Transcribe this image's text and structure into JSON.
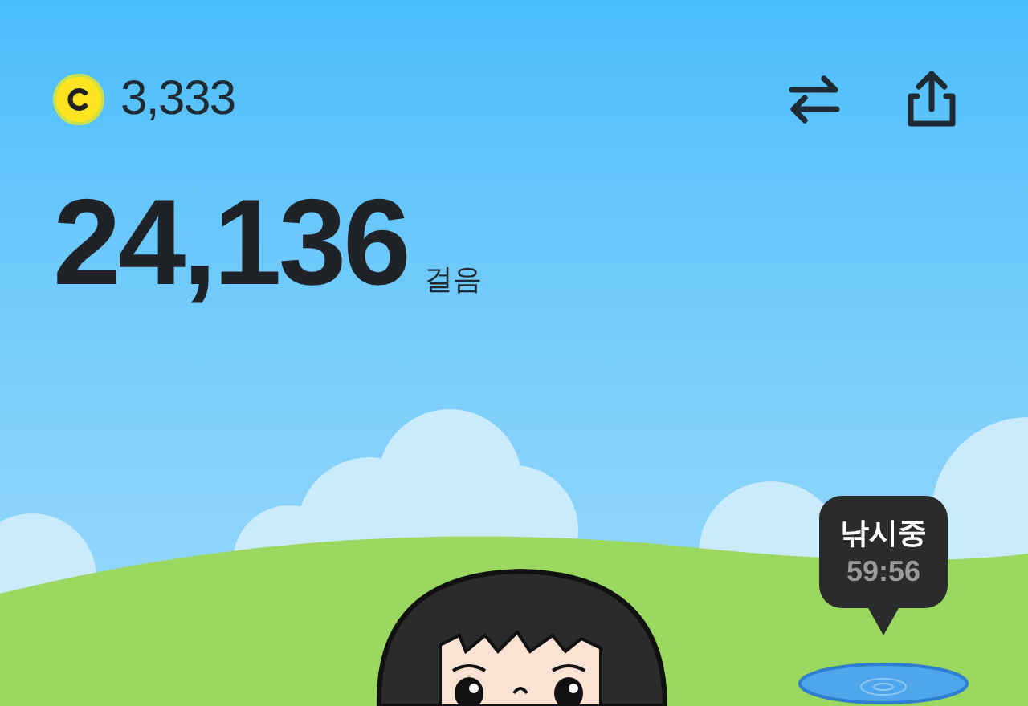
{
  "coins": "3,333",
  "steps": {
    "value": "24,136",
    "unit": "걸음"
  },
  "fishing": {
    "label": "낚시중",
    "time": "59:56"
  }
}
